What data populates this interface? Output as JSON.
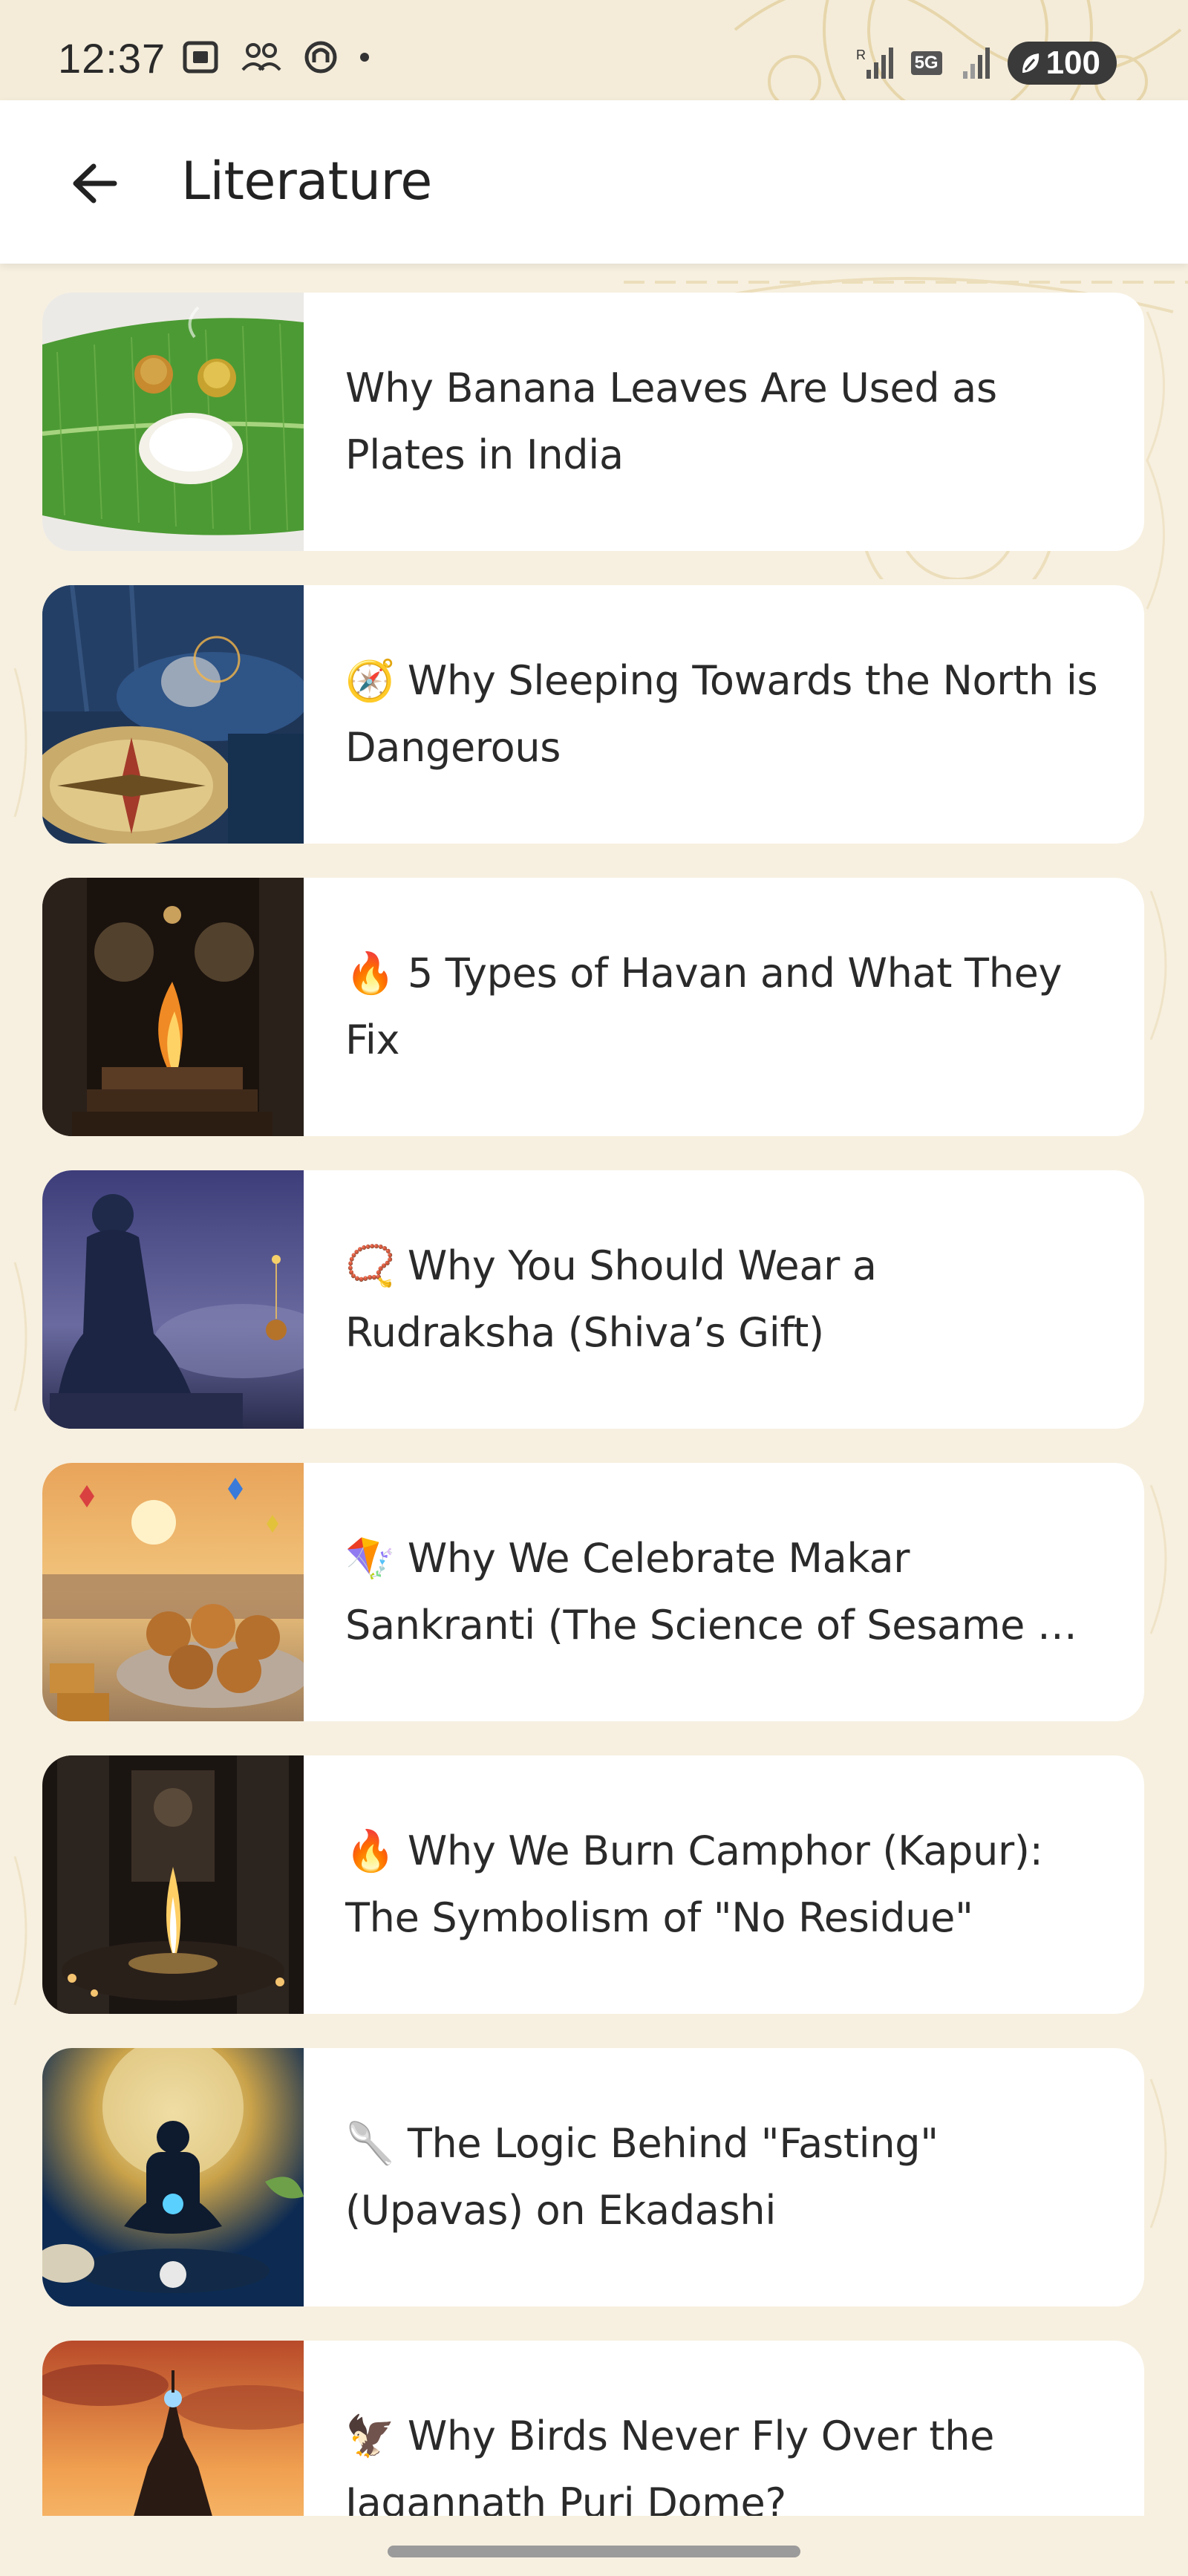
{
  "status_bar": {
    "time": "12:37",
    "battery": "100",
    "network": "5G"
  },
  "app_bar": {
    "title": "Literature"
  },
  "articles": [
    {
      "emoji": "",
      "title": "Why Banana Leaves Are Used as Plates in India",
      "thumb": "banana-leaf"
    },
    {
      "emoji": "🧭",
      "title": "Why Sleeping Towards the North is Dangerous",
      "thumb": "compass-sleep"
    },
    {
      "emoji": "🔥",
      "title": "5 Types of Havan and What They Fix",
      "thumb": "havan"
    },
    {
      "emoji": "📿",
      "title": "Why You Should Wear a Rudraksha (Shiva’s Gift)",
      "thumb": "shiva"
    },
    {
      "emoji": "🪁",
      "title": "Why We Celebrate Makar Sankranti (The Science of Sesame & Jaggery)",
      "thumb": "kites-ladoo"
    },
    {
      "emoji": "🔥",
      "title": "Why We Burn Camphor (Kapur): The Symbolism of \"No Residue\"",
      "thumb": "camphor-lamp"
    },
    {
      "emoji": "🥄",
      "title": "The Logic Behind \"Fasting\" (Upavas) on Ekadashi",
      "thumb": "meditation-moon"
    },
    {
      "emoji": "🦅",
      "title": "Why Birds Never Fly Over the Jagannath Puri Dome?",
      "thumb": "temple-sunset"
    }
  ]
}
